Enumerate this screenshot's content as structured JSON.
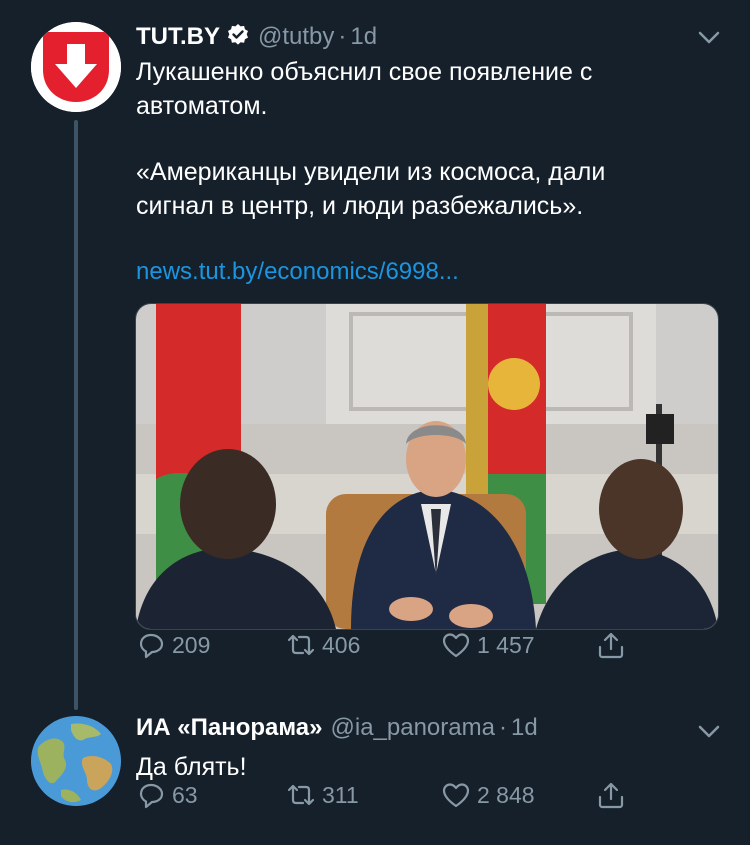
{
  "tweet1": {
    "name": "TUT.BY",
    "handle": "@tutby",
    "separator": "·",
    "time": "1d",
    "line1": "Лукашенко объяснил свое появление с",
    "line2": "автоматом.",
    "line3": "«Американцы увидели из космоса, дали",
    "line4": "сигнал в центр, и люди разбежались».",
    "link": "news.tut.by/economics/6998...",
    "replies": "209",
    "retweets": "406",
    "likes": "1 457"
  },
  "tweet2": {
    "name": "ИА «Панорама»",
    "handle": "@ia_panorama",
    "separator": "·",
    "time": "1d",
    "text": "Да блять!",
    "replies": "63",
    "retweets": "311",
    "likes": "2 848"
  },
  "colors": {
    "background": "#15202b",
    "link": "#1b95e0",
    "secondary": "#8899a6",
    "thread_line": "#3d5466",
    "tutby_red": "#e5202e"
  },
  "icons": [
    "tutby-logo-icon",
    "verified-badge-icon",
    "chevron-down-icon",
    "reply-icon",
    "retweet-icon",
    "like-icon",
    "share-icon",
    "globe-icon"
  ]
}
